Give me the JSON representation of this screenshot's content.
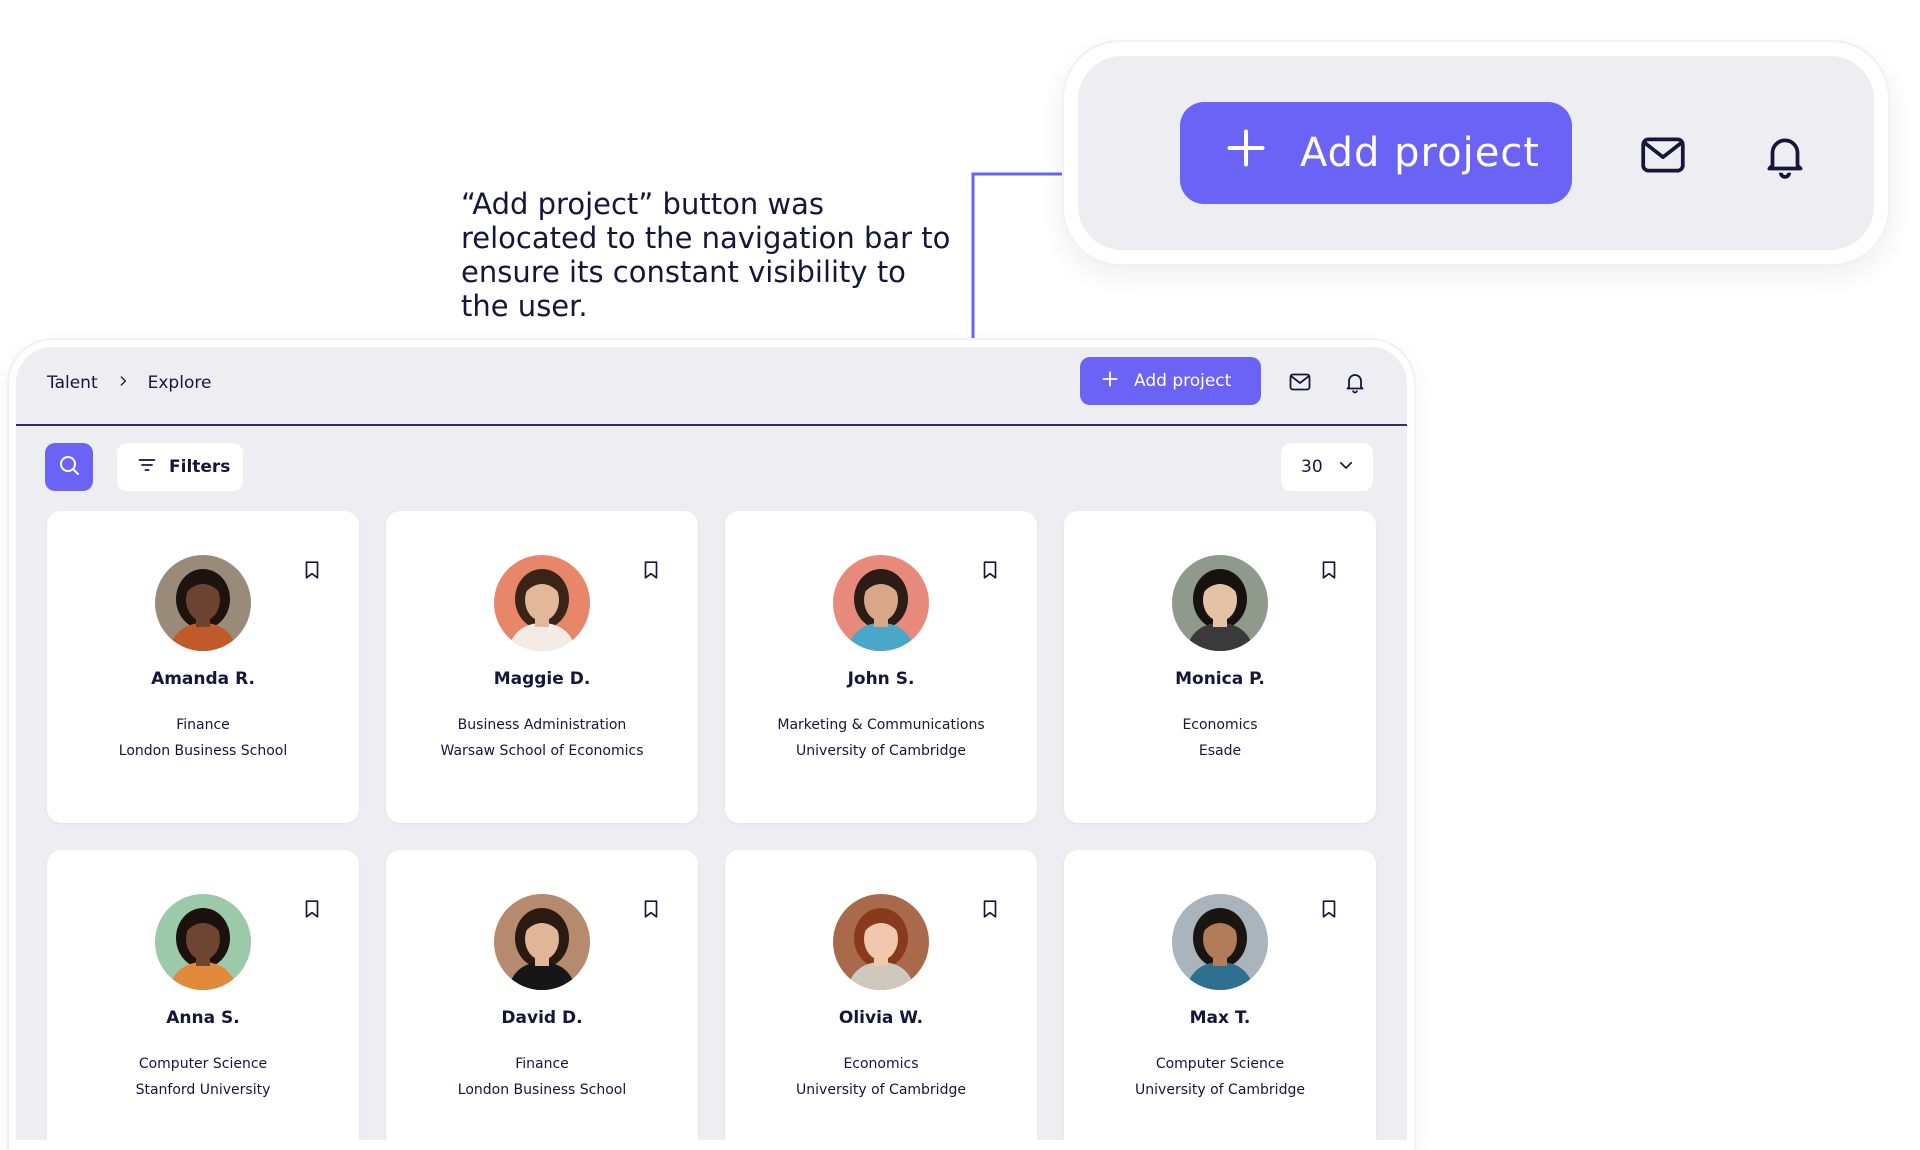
{
  "callout": {
    "add_label": "Add project",
    "annotation_text": "“Add project” button was relocated to the navigation bar to ensure its constant visibility to the user."
  },
  "nav": {
    "breadcrumb": [
      "Talent",
      "Explore"
    ],
    "add_label": "Add project"
  },
  "toolbar": {
    "filters_label": "Filters",
    "per_page": "30"
  },
  "colors": {
    "accent": "#6a63f5",
    "background": "#eeeef2",
    "text": "#14163a"
  },
  "profiles": [
    {
      "name": "Amanda R.",
      "field": "Finance",
      "school": "London Business School",
      "skin": "#6b4330",
      "hair": "#1e130e",
      "bg": "#9a8a7a",
      "shirt": "#c05a2a"
    },
    {
      "name": "Maggie D.",
      "field": "Business Administration",
      "school": "Warsaw School of Economics",
      "skin": "#e2b79a",
      "hair": "#3a2418",
      "bg": "#e8866a",
      "shirt": "#f2ece4"
    },
    {
      "name": "John S.",
      "field": "Marketing & Communications",
      "school": "University of Cambridge",
      "skin": "#d7a787",
      "hair": "#2b1d16",
      "bg": "#e78a7c",
      "shirt": "#4aa7c8"
    },
    {
      "name": "Monica P.",
      "field": "Economics",
      "school": "Esade",
      "skin": "#e4c2a6",
      "hair": "#17120f",
      "bg": "#8f9a8c",
      "shirt": "#3a3a3a"
    },
    {
      "name": "Anna S.",
      "field": "Computer Science",
      "school": "Stanford University",
      "skin": "#6e4530",
      "hair": "#1b120d",
      "bg": "#9cc9a9",
      "shirt": "#e08a3a"
    },
    {
      "name": "David D.",
      "field": "Finance",
      "school": "London Business School",
      "skin": "#e1b698",
      "hair": "#2a1a12",
      "bg": "#b58a6e",
      "shirt": "#161616"
    },
    {
      "name": "Olivia W.",
      "field": "Economics",
      "school": "University of Cambridge",
      "skin": "#f0c8ad",
      "hair": "#8a3a1c",
      "bg": "#a86a4a",
      "shirt": "#cfc8bf"
    },
    {
      "name": "Max T.",
      "field": "Computer Science",
      "school": "University of Cambridge",
      "skin": "#b07c5a",
      "hair": "#1b1512",
      "bg": "#a9b4bd",
      "shirt": "#2f6f8f"
    }
  ]
}
